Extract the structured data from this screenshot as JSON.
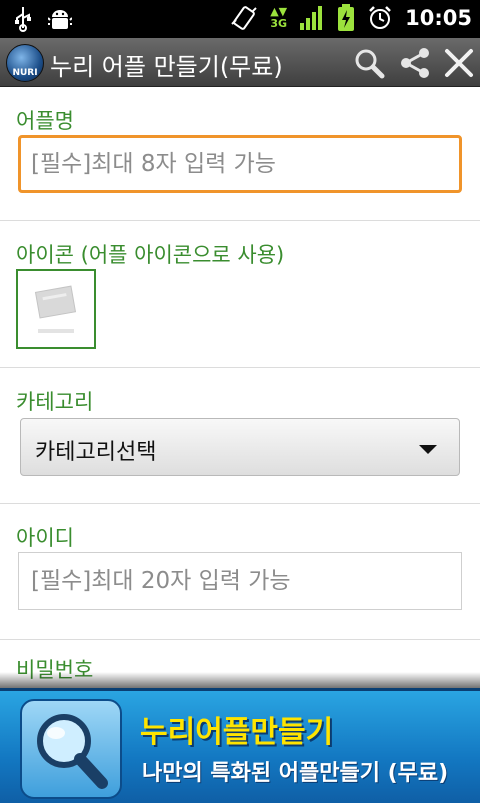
{
  "status_bar": {
    "time": "10:05",
    "network": "3G"
  },
  "app": {
    "title": "누리 어플 만들기(무료)",
    "logo_text": "NURI"
  },
  "form": {
    "app_name": {
      "label": "어플명",
      "placeholder": "[필수]최대 8자 입력 가능"
    },
    "icon": {
      "label": "아이콘 (어플 아이콘으로 사용)"
    },
    "category": {
      "label": "카테고리",
      "selected": "카테고리선택"
    },
    "user_id": {
      "label": "아이디",
      "placeholder": "[필수]최대 20자 입력 가능"
    },
    "password": {
      "label": "비밀번호"
    }
  },
  "banner": {
    "title": "누리어플만들기",
    "subtitle": "나만의 특화된 어플만들기 (무료)"
  },
  "colors": {
    "accent_green": "#3a8d2f",
    "focus_orange": "#f0942a",
    "banner_blue": "#1378c2",
    "banner_title_yellow": "#ffe400"
  },
  "icons": [
    "usb-icon",
    "android-debug-icon",
    "vibrate-icon",
    "signal-icon",
    "battery-charging-icon",
    "alarm-icon",
    "search-icon",
    "share-icon",
    "close-icon",
    "magnifier-icon"
  ]
}
